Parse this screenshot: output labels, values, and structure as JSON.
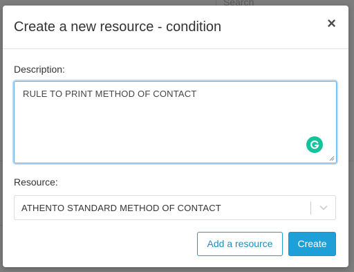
{
  "background": {
    "search_label": "Search"
  },
  "modal": {
    "title": "Create a new resource - condition",
    "close_glyph": "×",
    "description_label": "Description:",
    "description_value": "RULE TO PRINT METHOD OF CONTACT",
    "resource_label": "Resource:",
    "resource_selected": "ATHENTO STANDARD METHOD OF CONTACT",
    "add_resource_label": "Add a resource",
    "create_label": "Create"
  },
  "colors": {
    "primary": "#1e9fd8",
    "focus_border": "#66afe9",
    "grammarly": "#15c39a"
  },
  "icons": {
    "grammarly": "grammarly-icon",
    "dropdown": "chevron-down-icon",
    "close": "close-icon"
  }
}
